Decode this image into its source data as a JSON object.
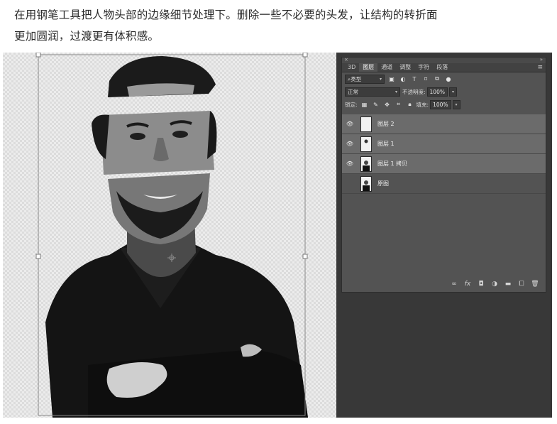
{
  "caption": {
    "line1": "在用钢笔工具把人物头部的边缘细节处理下。删除一些不必要的头发，让结构的转折面",
    "line2": "更加圆润，过渡更有体积感。"
  },
  "panel": {
    "tabs": [
      {
        "label": "3D",
        "active": false
      },
      {
        "label": "图层",
        "active": true
      },
      {
        "label": "通道",
        "active": false
      },
      {
        "label": "调整",
        "active": false
      },
      {
        "label": "字符",
        "active": false
      },
      {
        "label": "段落",
        "active": false
      }
    ],
    "filter": {
      "label": "类型"
    },
    "blend": {
      "mode": "正常",
      "opacity_label": "不透明度:",
      "opacity": "100%"
    },
    "lock": {
      "label": "锁定:",
      "fill_label": "填充:",
      "fill": "100%"
    },
    "layers": [
      {
        "name": "图层 2",
        "visible": true,
        "selected": true
      },
      {
        "name": "图层 1",
        "visible": true,
        "selected": true
      },
      {
        "name": "图层 1 拷贝",
        "visible": true,
        "selected": true
      },
      {
        "name": "原图",
        "visible": false,
        "selected": false
      }
    ]
  }
}
